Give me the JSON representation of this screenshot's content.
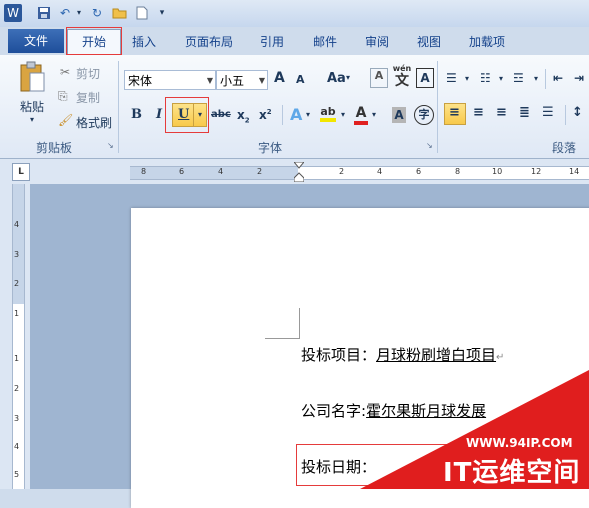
{
  "titlebar": {
    "app_icon": "W",
    "quick_access": [
      "save-icon",
      "undo-icon",
      "redo-icon",
      "open-folder-icon",
      "new-document-icon",
      "customize-icon"
    ]
  },
  "tabs": [
    "文件",
    "开始",
    "插入",
    "页面布局",
    "引用",
    "邮件",
    "审阅",
    "视图",
    "加载项"
  ],
  "clipboard": {
    "paste": "粘贴",
    "cut": "剪切",
    "copy": "复制",
    "format_painter": "格式刷",
    "group_label": "剪贴板"
  },
  "font": {
    "font_name": "宋体",
    "font_size": "小五",
    "grow": "A",
    "shrink": "A",
    "case": "Aa",
    "clear": "A",
    "phonetic": "wén",
    "phonetic_char": "文",
    "border": "A",
    "bold": "B",
    "italic": "I",
    "underline": "U",
    "strikethrough": "abc",
    "subscript": "x",
    "superscript": "x",
    "subscript_mark": "2",
    "superscript_mark": "2",
    "text_effect": "A",
    "highlight": "ab",
    "font_color": "A",
    "shading": "A",
    "enclose": "字",
    "group_label": "字体"
  },
  "paragraph": {
    "group_label": "段落"
  },
  "ruler_numbers": [
    "8",
    "6",
    "4",
    "2",
    "2",
    "4",
    "6",
    "8",
    "10",
    "12",
    "14"
  ],
  "vruler_numbers": [
    "4",
    "3",
    "2",
    "1",
    "1",
    "2",
    "3",
    "4",
    "5"
  ],
  "document": {
    "line1_label": "投标项目：",
    "line1_value": "月球粉刷增白项目",
    "line2_label": "公司名字:",
    "line2_value": "霍尔果斯月球发展",
    "line3_label": "投标日期：",
    "line3_value": ""
  },
  "watermark": {
    "url": "WWW.94IP.COM",
    "text": "IT运维空间"
  },
  "colors": {
    "accent_red": "#e53b3b",
    "file_tab": "#2a5ba6",
    "ribbon_bg": "#dfe8f5"
  }
}
